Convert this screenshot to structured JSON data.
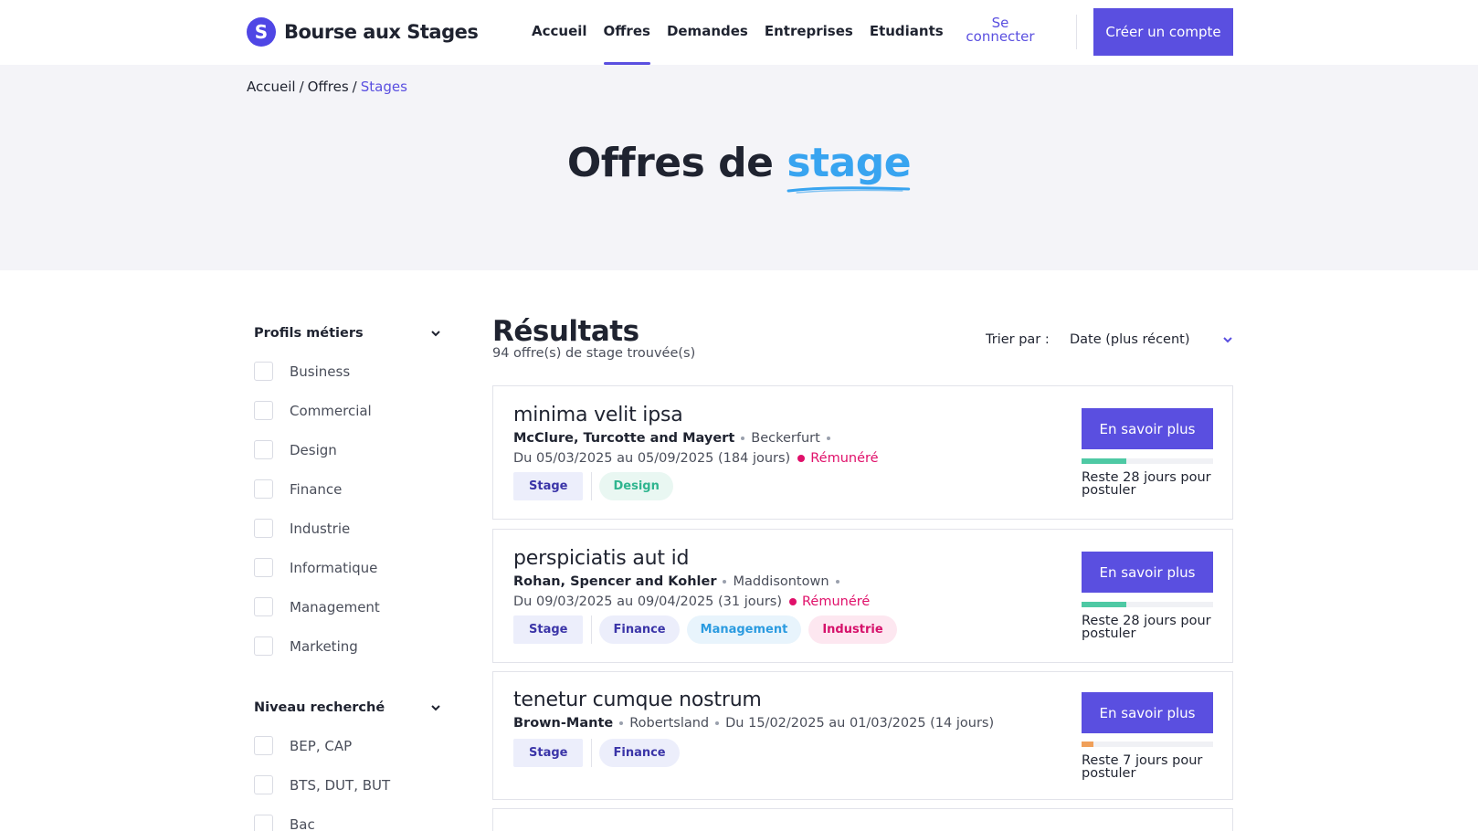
{
  "header": {
    "logo_letter": "S",
    "logo_text": "Bourse aux Stages",
    "nav": [
      {
        "label": "Accueil"
      },
      {
        "label": "Offres"
      },
      {
        "label": "Demandes"
      },
      {
        "label": "Entreprises"
      },
      {
        "label": "Etudiants"
      }
    ],
    "active_nav": "Offres",
    "login_label": "Se connecter",
    "signup_label": "Créer un compte"
  },
  "breadcrumb": [
    "Accueil",
    "Offres",
    "Stages"
  ],
  "hero": {
    "title_prefix": "Offres de",
    "title_accent": "stage"
  },
  "filters": [
    {
      "title": "Profils métiers",
      "items": [
        "Business",
        "Commercial",
        "Design",
        "Finance",
        "Industrie",
        "Informatique",
        "Management",
        "Marketing"
      ]
    },
    {
      "title": "Niveau recherché",
      "items": [
        "BEP, CAP",
        "BTS, DUT, BUT",
        "Bac"
      ]
    }
  ],
  "results": {
    "title": "Résultats",
    "count": "94 offre(s) de stage trouvée(s)",
    "sort_label": "Trier par :",
    "sort_value": "Date (plus récent)"
  },
  "offers": [
    {
      "title": "minima velit ipsa",
      "company": "McClure, Turcotte and Mayert",
      "city": "Beckerfurt",
      "dates": "Du 05/03/2025 au 05/09/2025 (184 jours)",
      "paid": "Rémunéré",
      "type": "Stage",
      "tags": [
        {
          "label": "Design",
          "color": "#2fb58f",
          "bg": "#e9f7f2"
        }
      ],
      "button": "En savoir plus",
      "remaining": "Reste 28 jours pour postuler",
      "progress": 0.34,
      "progress_color": "#4ec9a4"
    },
    {
      "title": "perspiciatis aut id",
      "company": "Rohan, Spencer and Kohler",
      "city": "Maddisontown",
      "dates": "Du 09/03/2025 au 09/04/2025 (31 jours)",
      "paid": "Rémunéré",
      "type": "Stage",
      "tags": [
        {
          "label": "Finance",
          "color": "#3b35a8",
          "bg": "#eceefb"
        },
        {
          "label": "Management",
          "color": "#2b9be0",
          "bg": "#e8f4fc"
        },
        {
          "label": "Industrie",
          "color": "#d6126b",
          "bg": "#fde7f0"
        }
      ],
      "button": "En savoir plus",
      "remaining": "Reste 28 jours pour postuler",
      "progress": 0.34,
      "progress_color": "#4ec9a4"
    },
    {
      "title": "tenetur cumque nostrum",
      "company": "Brown-Mante",
      "city": "Robertsland",
      "dates": "Du 15/02/2025 au 01/03/2025 (14 jours)",
      "paid": "",
      "type": "Stage",
      "tags": [
        {
          "label": "Finance",
          "color": "#3b35a8",
          "bg": "#eceefb"
        }
      ],
      "button": "En savoir plus",
      "remaining": "Reste 7 jours pour postuler",
      "progress": 0.09,
      "progress_color": "#f0a05a"
    }
  ],
  "colors": {
    "primary": "#5a4fe0",
    "accent": "#38a4f0",
    "paid": "#e0106a"
  }
}
